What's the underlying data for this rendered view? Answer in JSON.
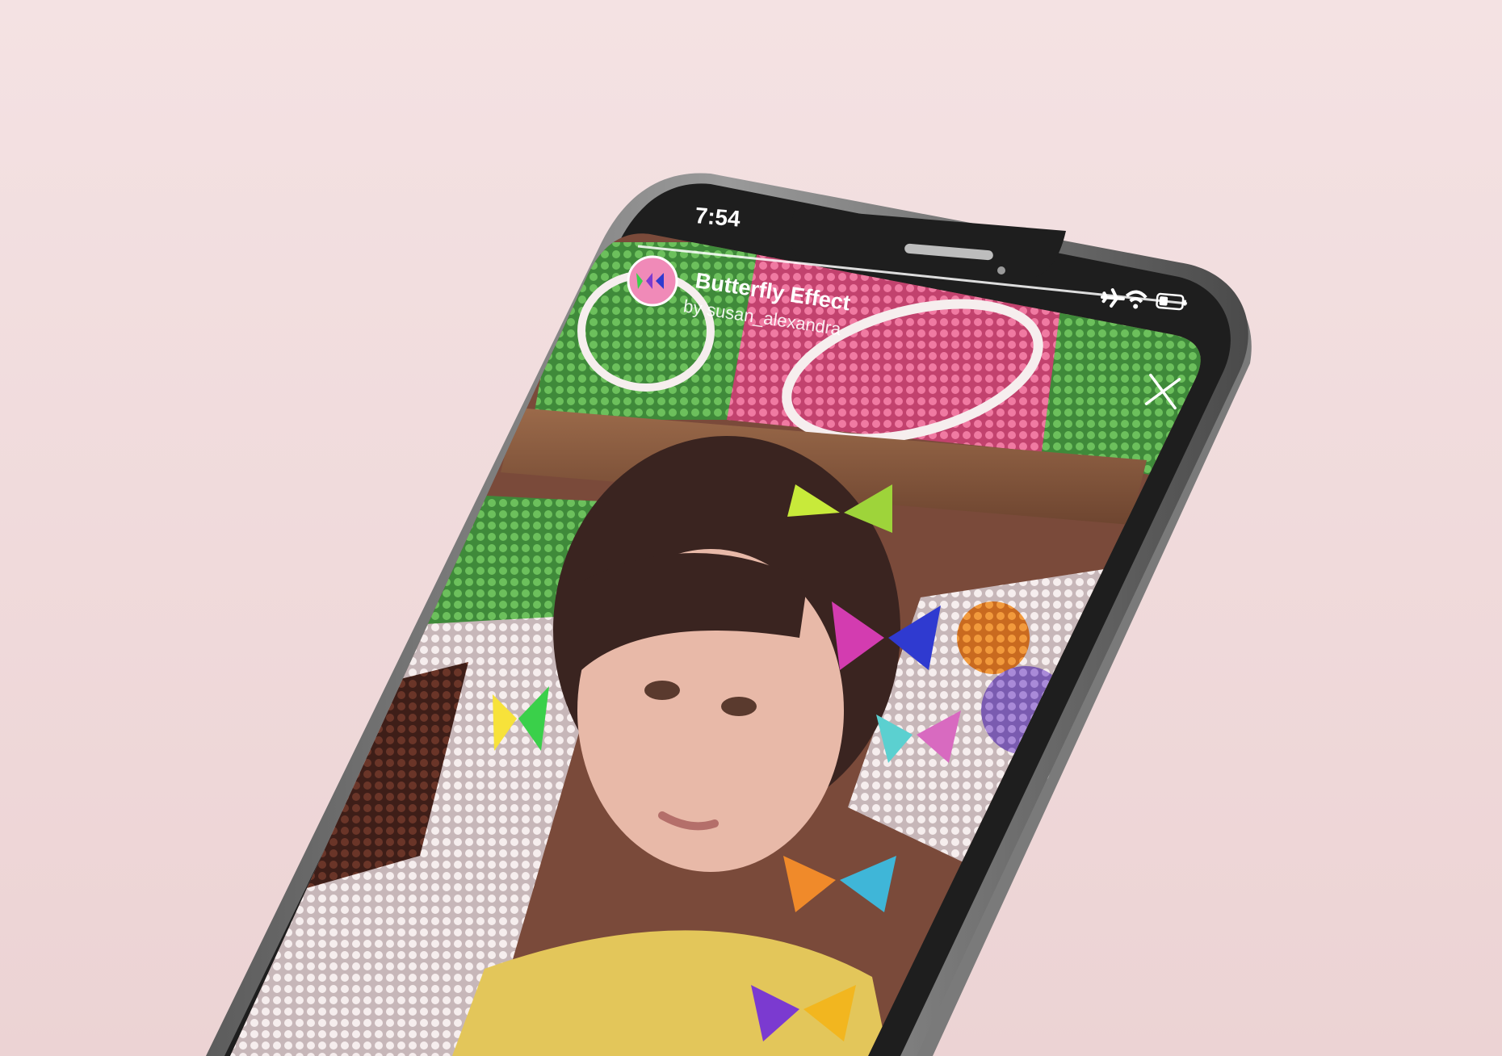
{
  "status_bar": {
    "time": "7:54",
    "icons": [
      "airplane-icon",
      "wifi-icon",
      "battery-icon"
    ]
  },
  "effect": {
    "name": "Butterfly Effect",
    "creator": "by susan_alexandra",
    "icon": "butterfly-effect-avatar"
  },
  "controls": {
    "close_icon": "close-icon"
  },
  "colors": {
    "background": "#f3e0e1",
    "phone_frame": "#6f6f6f",
    "phone_bezel": "#1e1e1e",
    "text": "#ffffff"
  }
}
